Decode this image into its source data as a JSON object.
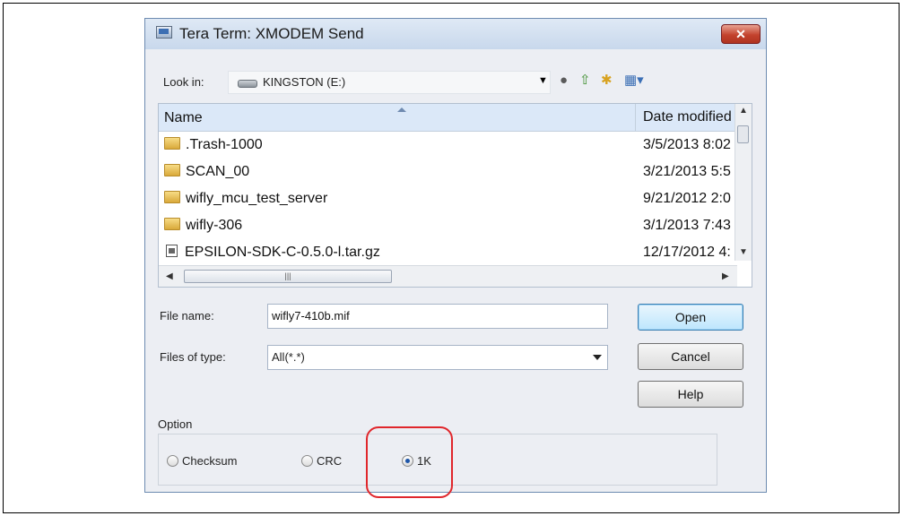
{
  "dialog": {
    "title": "Tera Term: XMODEM Send",
    "close_label": "✕"
  },
  "lookin": {
    "label": "Look in:",
    "value": "KINGSTON (E:)",
    "toolbar_icons": [
      "back-icon",
      "up-folder-icon",
      "new-folder-icon",
      "view-menu-icon"
    ]
  },
  "filelist": {
    "columns": [
      "Name",
      "Date modified"
    ],
    "rows": [
      {
        "name": ".Trash-1000",
        "date": "3/5/2013 8:02",
        "type": "folder"
      },
      {
        "name": "SCAN_00",
        "date": "3/21/2013 5:5",
        "type": "folder"
      },
      {
        "name": "wifly_mcu_test_server",
        "date": "9/21/2012 2:0",
        "type": "folder"
      },
      {
        "name": "wifly-306",
        "date": "3/1/2013 7:43",
        "type": "folder"
      },
      {
        "name": "EPSILON-SDK-C-0.5.0-l.tar.gz",
        "date": "12/17/2012 4:",
        "type": "file"
      }
    ]
  },
  "form": {
    "filename_label": "File name:",
    "filename_value": "wifly7-410b.mif",
    "filetype_label": "Files of type:",
    "filetype_value": "All(*.*)"
  },
  "buttons": {
    "open": "Open",
    "cancel": "Cancel",
    "help": "Help"
  },
  "options": {
    "group_label": "Option",
    "items": [
      "Checksum",
      "CRC",
      "1K"
    ],
    "selected": "1K"
  },
  "colors": {
    "highlight": "#e0262b",
    "close_button": "#c3432e"
  }
}
